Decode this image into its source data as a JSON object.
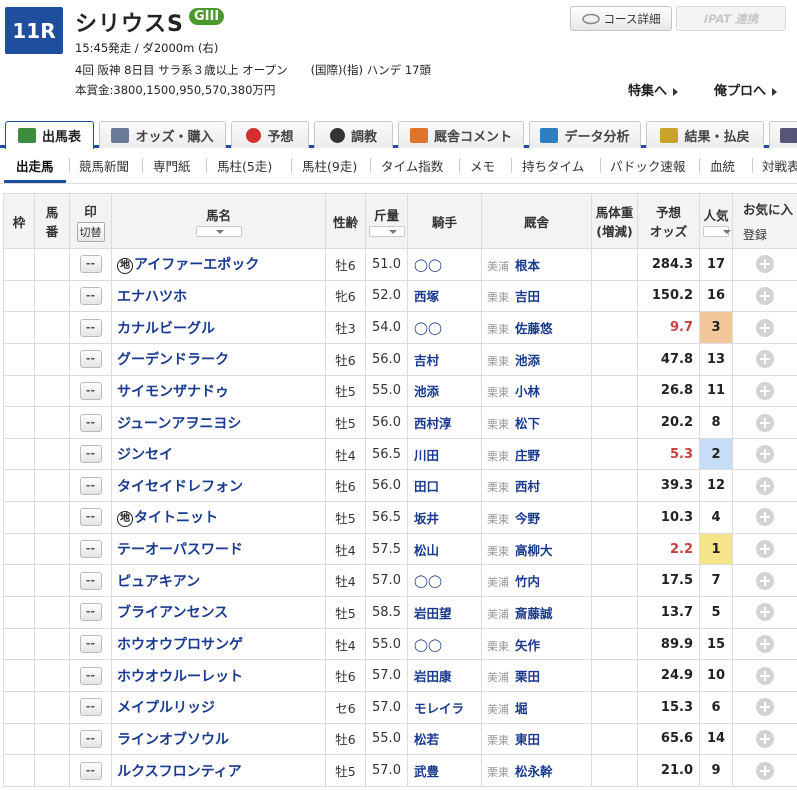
{
  "race": {
    "number": "11R",
    "name": "シリウスS",
    "grade": "GIII",
    "line1": "15:45発走 / ダ2000m (右)",
    "line2": "4回 阪神 8日目 サラ系３歳以上 オープン　　(国際)(指) ハンデ 17頭",
    "line3": "本賞金:3800,1500,950,570,380万円",
    "course_btn": "コース詳細",
    "ipat_btn": "IPAT 連携",
    "link_special": "特集へ",
    "link_orepro": "俺プロへ"
  },
  "tabs": [
    "出馬表",
    "オッズ・購入",
    "予想",
    "調教",
    "厩舎コメント",
    "データ分析",
    "結果・払戻",
    ""
  ],
  "tab_icon_colors": [
    "#3d8b3d",
    "#6a7a96",
    "#d23030",
    "#333333",
    "#e0742a",
    "#2e7fc0",
    "#c9a227",
    "#555577"
  ],
  "subtabs": [
    "出走馬",
    "競馬新聞",
    "専門紙",
    "馬柱(5走)",
    "馬柱(9走)",
    "タイム指数",
    "メモ",
    "持ちタイム",
    "パドック速報",
    "血統",
    "対戦表"
  ],
  "header": {
    "waku": "枠",
    "umaban_1": "馬",
    "umaban_2": "番",
    "mark": "印",
    "switch": "切替",
    "name": "馬名",
    "sexage": "性齢",
    "kinryo": "斤量",
    "jockey": "騎手",
    "stable": "厩舎",
    "weight_1": "馬体重",
    "weight_2": "(増減)",
    "odds_1": "予想",
    "odds_2": "オッズ",
    "pop": "人気",
    "fav": "お気に入",
    "register": "登録"
  },
  "mark_placeholder": "--",
  "chi_mark": "地",
  "horses": [
    {
      "name": "アイファーエポック",
      "chi": true,
      "sexage": "牡6",
      "kinryo": "51.0",
      "jockey": "◯◯",
      "region": "美浦",
      "trainer": "根本",
      "odds": "284.3",
      "pop": "17",
      "odds_color": "#222",
      "pop_bg": ""
    },
    {
      "name": "エナハツホ",
      "chi": false,
      "sexage": "牝6",
      "kinryo": "52.0",
      "jockey": "西塚",
      "region": "栗東",
      "trainer": "吉田",
      "odds": "150.2",
      "pop": "16",
      "odds_color": "#222",
      "pop_bg": ""
    },
    {
      "name": "カナルビーグル",
      "chi": false,
      "sexage": "牡3",
      "kinryo": "54.0",
      "jockey": "◯◯",
      "region": "栗東",
      "trainer": "佐藤悠",
      "odds": "9.7",
      "pop": "3",
      "odds_color": "#c84040",
      "pop_bg": "#f4c79a"
    },
    {
      "name": "グーデンドラーク",
      "chi": false,
      "sexage": "牡6",
      "kinryo": "56.0",
      "jockey": "吉村",
      "region": "栗東",
      "trainer": "池添",
      "odds": "47.8",
      "pop": "13",
      "odds_color": "#222",
      "pop_bg": ""
    },
    {
      "name": "サイモンザナドゥ",
      "chi": false,
      "sexage": "牡5",
      "kinryo": "55.0",
      "jockey": "池添",
      "region": "栗東",
      "trainer": "小林",
      "odds": "26.8",
      "pop": "11",
      "odds_color": "#222",
      "pop_bg": ""
    },
    {
      "name": "ジューンアヲニヨシ",
      "chi": false,
      "sexage": "牡5",
      "kinryo": "56.0",
      "jockey": "西村淳",
      "region": "栗東",
      "trainer": "松下",
      "odds": "20.2",
      "pop": "8",
      "odds_color": "#222",
      "pop_bg": ""
    },
    {
      "name": "ジンセイ",
      "chi": false,
      "sexage": "牡4",
      "kinryo": "56.5",
      "jockey": "川田",
      "region": "栗東",
      "trainer": "庄野",
      "odds": "5.3",
      "pop": "2",
      "odds_color": "#c84040",
      "pop_bg": "#c6dcf7"
    },
    {
      "name": "タイセイドレフォン",
      "chi": false,
      "sexage": "牡6",
      "kinryo": "56.0",
      "jockey": "田口",
      "region": "栗東",
      "trainer": "西村",
      "odds": "39.3",
      "pop": "12",
      "odds_color": "#222",
      "pop_bg": ""
    },
    {
      "name": "タイトニット",
      "chi": true,
      "sexage": "牡5",
      "kinryo": "56.5",
      "jockey": "坂井",
      "region": "栗東",
      "trainer": "今野",
      "odds": "10.3",
      "pop": "4",
      "odds_color": "#222",
      "pop_bg": ""
    },
    {
      "name": "テーオーパスワード",
      "chi": false,
      "sexage": "牡4",
      "kinryo": "57.5",
      "jockey": "松山",
      "region": "栗東",
      "trainer": "高柳大",
      "odds": "2.2",
      "pop": "1",
      "odds_color": "#c84040",
      "pop_bg": "#f6e48a"
    },
    {
      "name": "ピュアキアン",
      "chi": false,
      "sexage": "牡4",
      "kinryo": "57.0",
      "jockey": "◯◯",
      "region": "美浦",
      "trainer": "竹内",
      "odds": "17.5",
      "pop": "7",
      "odds_color": "#222",
      "pop_bg": ""
    },
    {
      "name": "ブライアンセンス",
      "chi": false,
      "sexage": "牡5",
      "kinryo": "58.5",
      "jockey": "岩田望",
      "region": "美浦",
      "trainer": "斎藤誠",
      "odds": "13.7",
      "pop": "5",
      "odds_color": "#222",
      "pop_bg": ""
    },
    {
      "name": "ホウオウプロサンゲ",
      "chi": false,
      "sexage": "牡4",
      "kinryo": "55.0",
      "jockey": "◯◯",
      "region": "栗東",
      "trainer": "矢作",
      "odds": "89.9",
      "pop": "15",
      "odds_color": "#222",
      "pop_bg": ""
    },
    {
      "name": "ホウオウルーレット",
      "chi": false,
      "sexage": "牡6",
      "kinryo": "57.0",
      "jockey": "岩田康",
      "region": "美浦",
      "trainer": "栗田",
      "odds": "24.9",
      "pop": "10",
      "odds_color": "#222",
      "pop_bg": ""
    },
    {
      "name": "メイプルリッジ",
      "chi": false,
      "sexage": "セ6",
      "kinryo": "57.0",
      "jockey": "モレイラ",
      "region": "美浦",
      "trainer": "堀",
      "odds": "15.3",
      "pop": "6",
      "odds_color": "#222",
      "pop_bg": ""
    },
    {
      "name": "ラインオブソウル",
      "chi": false,
      "sexage": "牡6",
      "kinryo": "55.0",
      "jockey": "松若",
      "region": "栗東",
      "trainer": "東田",
      "odds": "65.6",
      "pop": "14",
      "odds_color": "#222",
      "pop_bg": ""
    },
    {
      "name": "ルクスフロンティア",
      "chi": false,
      "sexage": "牡5",
      "kinryo": "57.0",
      "jockey": "武豊",
      "region": "栗東",
      "trainer": "松永幹",
      "odds": "21.0",
      "pop": "9",
      "odds_color": "#222",
      "pop_bg": ""
    }
  ]
}
